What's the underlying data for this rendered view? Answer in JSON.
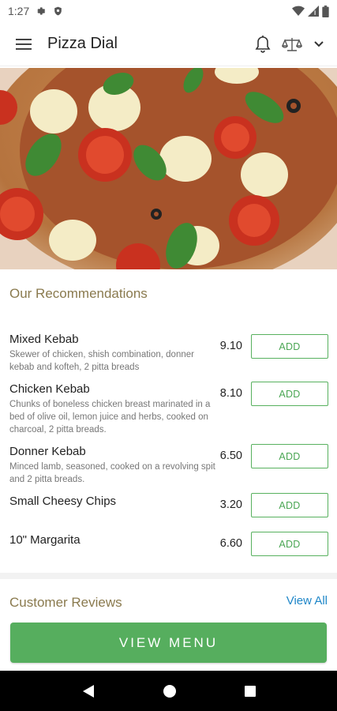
{
  "status": {
    "time": "1:27"
  },
  "app": {
    "title": "Pizza Dial"
  },
  "recommendations": {
    "title": "Our Recommendations",
    "add_label": "ADD",
    "items": [
      {
        "name": "Mixed Kebab",
        "desc": "Skewer of chicken, shish combination, donner kebab and kofteh, 2 pitta breads",
        "price": "9.10"
      },
      {
        "name": "Chicken Kebab",
        "desc": "Chunks of boneless chicken breast marinated in a bed of olive oil, lemon juice and herbs, cooked on charcoal, 2 pitta breads.",
        "price": "8.10"
      },
      {
        "name": "Donner Kebab",
        "desc": "Minced lamb, seasoned, cooked on a revolving spit and 2 pitta breads.",
        "price": "6.50"
      },
      {
        "name": "Small Cheesy Chips",
        "desc": "",
        "price": "3.20"
      },
      {
        "name": "10\" Margarita",
        "desc": "",
        "price": "6.60"
      }
    ]
  },
  "reviews": {
    "title": "Customer Reviews",
    "view_all": "View All"
  },
  "cta": {
    "view_menu": "VIEW MENU"
  },
  "colors": {
    "accent_green": "#56ae5e",
    "section_title": "#8a7a4e",
    "link_blue": "#1e86c8"
  },
  "icons": [
    "settings-icon",
    "shield-icon",
    "wifi-icon",
    "signal-icon",
    "battery-icon",
    "hamburger-menu-icon",
    "bell-icon",
    "scale-icon",
    "chevron-down-icon",
    "back-icon",
    "home-icon",
    "recents-icon"
  ]
}
